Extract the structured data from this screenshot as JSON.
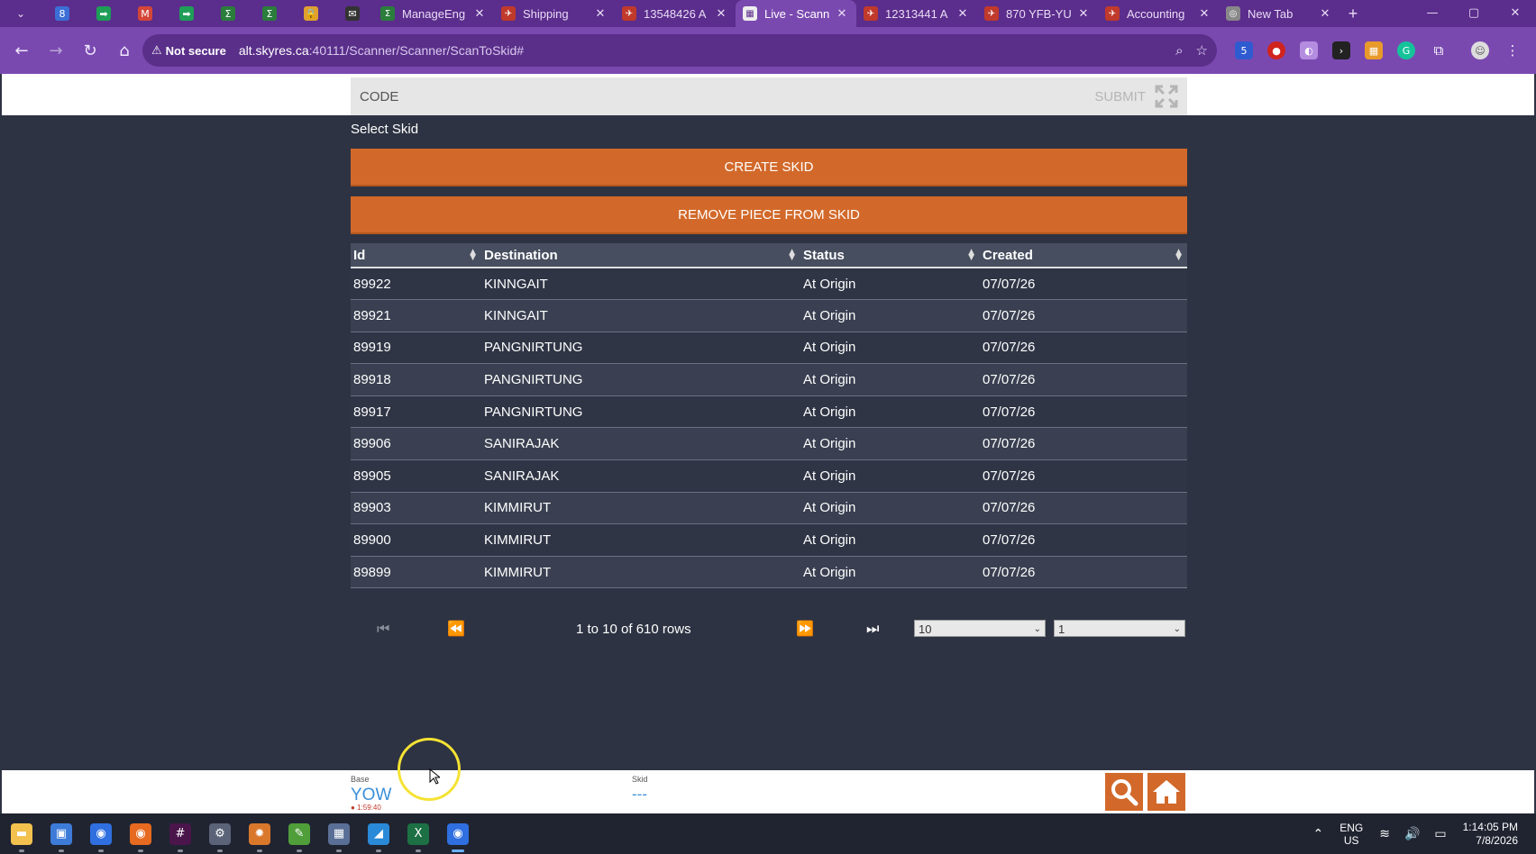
{
  "browser": {
    "pinned_tabs": [
      {
        "icon": "calendar-icon",
        "color": "#3b6fd6",
        "glyph": "8"
      },
      {
        "icon": "meet-icon",
        "color": "#1e9e57",
        "glyph": "➡"
      },
      {
        "icon": "gmail-icon",
        "color": "#d44638",
        "glyph": "M"
      },
      {
        "icon": "meet-icon",
        "color": "#1e9e57",
        "glyph": "➡"
      },
      {
        "icon": "manageengine-icon",
        "color": "#2a7d3b",
        "glyph": "Σ"
      },
      {
        "icon": "manageengine-icon",
        "color": "#2a7d3b",
        "glyph": "Σ"
      },
      {
        "icon": "lock-icon",
        "color": "#e0a030",
        "glyph": "🔒"
      },
      {
        "icon": "mail-icon",
        "color": "#333333",
        "glyph": "✉"
      }
    ],
    "tabs": [
      {
        "title": "ManageEng",
        "icon": "manageengine-icon",
        "color": "#2a7d3b",
        "glyph": "Σ",
        "active": false
      },
      {
        "title": "Shipping",
        "icon": "skyres-icon",
        "color": "#c0392b",
        "glyph": "✈",
        "active": false
      },
      {
        "title": "13548426 A",
        "icon": "skyres-icon",
        "color": "#c0392b",
        "glyph": "✈",
        "active": false
      },
      {
        "title": "Live - Scann",
        "icon": "scanner-icon",
        "color": "#eeeeee",
        "glyph": "▦",
        "active": true
      },
      {
        "title": "12313441 A",
        "icon": "skyres-icon",
        "color": "#c0392b",
        "glyph": "✈",
        "active": false
      },
      {
        "title": "870 YFB-YU",
        "icon": "skyres-icon",
        "color": "#c0392b",
        "glyph": "✈",
        "active": false
      },
      {
        "title": "Accounting",
        "icon": "skyres-icon",
        "color": "#c0392b",
        "glyph": "✈",
        "active": false
      },
      {
        "title": "New Tab",
        "icon": "chrome-icon",
        "color": "#888888",
        "glyph": "◎",
        "active": false
      }
    ],
    "new_tab_label": "+",
    "close_glyph": "✕",
    "security_label": "Not secure",
    "url_host": "alt.skyres.ca",
    "url_path": ":40111/Scanner/Scanner/ScanToSkid#",
    "extension_badge": "5"
  },
  "scanner": {
    "code_placeholder": "CODE",
    "submit_label": "SUBMIT",
    "select_skid_label": "Select Skid",
    "create_skid_label": "CREATE SKID",
    "remove_piece_label": "REMOVE PIECE FROM SKID",
    "columns": [
      "Id",
      "Destination",
      "Status",
      "Created"
    ],
    "rows": [
      [
        "89922",
        "KINNGAIT",
        "At Origin",
        "07/07/26"
      ],
      [
        "89921",
        "KINNGAIT",
        "At Origin",
        "07/07/26"
      ],
      [
        "89919",
        "PANGNIRTUNG",
        "At Origin",
        "07/07/26"
      ],
      [
        "89918",
        "PANGNIRTUNG",
        "At Origin",
        "07/07/26"
      ],
      [
        "89917",
        "PANGNIRTUNG",
        "At Origin",
        "07/07/26"
      ],
      [
        "89906",
        "SANIRAJAK",
        "At Origin",
        "07/07/26"
      ],
      [
        "89905",
        "SANIRAJAK",
        "At Origin",
        "07/07/26"
      ],
      [
        "89903",
        "KIMMIRUT",
        "At Origin",
        "07/07/26"
      ],
      [
        "89900",
        "KIMMIRUT",
        "At Origin",
        "07/07/26"
      ],
      [
        "89899",
        "KIMMIRUT",
        "At Origin",
        "07/07/26"
      ]
    ],
    "pager": {
      "rows_info": "1 to 10 of 610 rows",
      "page_size": "10",
      "page_number": "1"
    }
  },
  "footer": {
    "base_label": "Base",
    "base_value": "YOW",
    "base_time": "1:59:40",
    "skid_label": "Skid",
    "skid_value": "---"
  },
  "taskbar": {
    "apps": [
      {
        "icon": "file-explorer-icon",
        "color": "#f2c14e",
        "glyph": "▬"
      },
      {
        "icon": "remote-desktop-icon",
        "color": "#3d7bd9",
        "glyph": "▣"
      },
      {
        "icon": "chrome-profile-icon",
        "color": "#2f6fe0",
        "glyph": "◉"
      },
      {
        "icon": "firefox-icon",
        "color": "#e66a1f",
        "glyph": "◉"
      },
      {
        "icon": "slack-icon",
        "color": "#4a154b",
        "glyph": "#"
      },
      {
        "icon": "settings-icon",
        "color": "#5a6378",
        "glyph": "⚙"
      },
      {
        "icon": "claude-icon",
        "color": "#d9772b",
        "glyph": "✹"
      },
      {
        "icon": "notepad-icon",
        "color": "#4f9e3a",
        "glyph": "✎"
      },
      {
        "icon": "calculator-icon",
        "color": "#5a6f95",
        "glyph": "▦"
      },
      {
        "icon": "paint-icon",
        "color": "#2a8ad8",
        "glyph": "◢"
      },
      {
        "icon": "excel-icon",
        "color": "#1d7044",
        "glyph": "X"
      },
      {
        "icon": "chrome-icon",
        "color": "#2f6fe0",
        "glyph": "◉"
      }
    ],
    "active_index": 11,
    "tray_lang_1": "ENG",
    "tray_lang_2": "US",
    "time": "1:14:05 PM",
    "date": "7/8/2026"
  }
}
